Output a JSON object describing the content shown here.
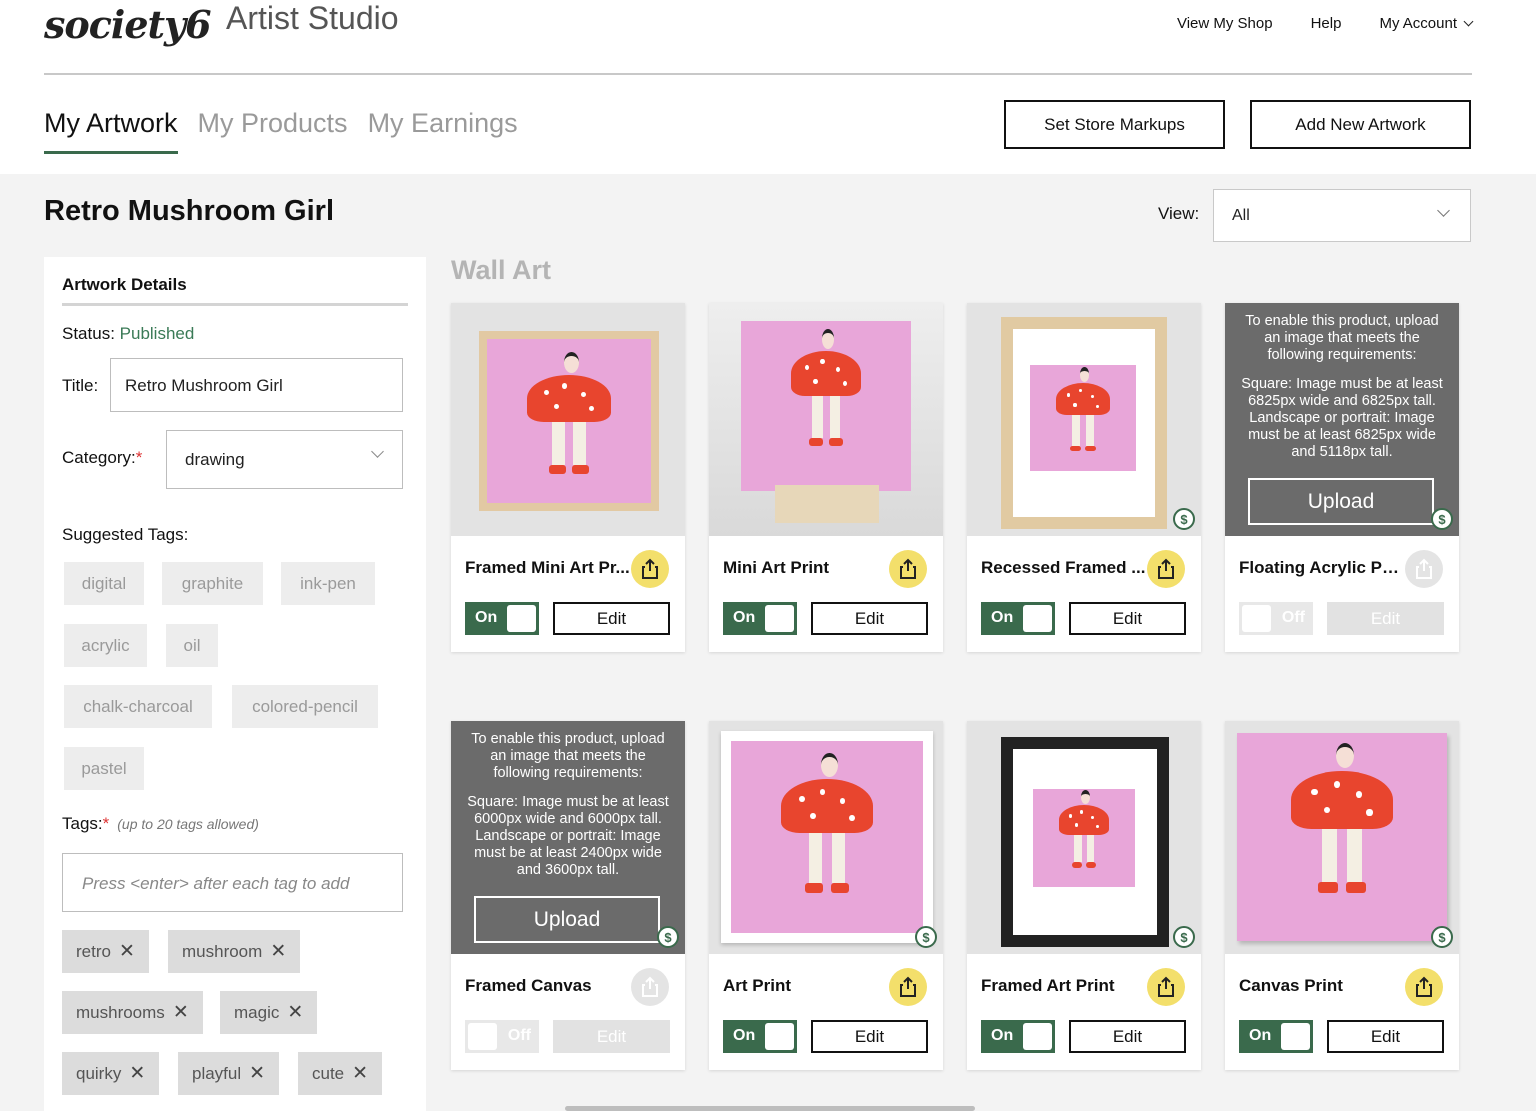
{
  "brand": {
    "logo": "society6",
    "studio": "Artist Studio"
  },
  "topnav": {
    "view_shop": "View My Shop",
    "help": "Help",
    "account": "My Account"
  },
  "tabs": [
    {
      "label": "My Artwork",
      "active": true
    },
    {
      "label": "My Products",
      "active": false
    },
    {
      "label": "My Earnings",
      "active": false
    }
  ],
  "buttons": {
    "markups": "Set Store Markups",
    "add": "Add New Artwork"
  },
  "artwork": {
    "title": "Retro Mushroom Girl",
    "view_label": "View:",
    "view_value": "All"
  },
  "details": {
    "heading": "Artwork Details",
    "status_label": "Status:",
    "status_value": "Published",
    "title_label": "Title:",
    "title_value": "Retro Mushroom Girl",
    "category_label": "Category:",
    "category_value": "drawing",
    "suggested_label": "Suggested Tags:",
    "suggested": [
      "digital",
      "graphite",
      "ink-pen",
      "acrylic",
      "oil",
      "chalk-charcoal",
      "colored-pencil",
      "pastel"
    ],
    "tags_label": "Tags:",
    "tags_hint": "(up to 20 tags allowed)",
    "tags_placeholder": "Press <enter> after each tag to add",
    "tags": [
      "retro",
      "mushroom",
      "mushrooms",
      "magic",
      "quirky",
      "playful",
      "cute"
    ]
  },
  "section": {
    "title": "Wall Art"
  },
  "products": [
    {
      "name": "Framed Mini Art Pr...",
      "enabled": true,
      "toggle": "On",
      "edit": "Edit",
      "dollar": false
    },
    {
      "name": "Mini Art Print",
      "enabled": true,
      "toggle": "On",
      "edit": "Edit",
      "dollar": false
    },
    {
      "name": "Recessed Framed ...",
      "enabled": true,
      "toggle": "On",
      "edit": "Edit",
      "dollar": true
    },
    {
      "name": "Floating Acrylic Pri...",
      "enabled": false,
      "toggle": "Off",
      "edit": "Edit",
      "dollar": true,
      "overlay_1": "To enable this product, upload an image that meets the following requirements:",
      "overlay_2": "Square: Image must be at least 6825px wide and 6825px tall. Landscape or portrait: Image must be at least 6825px wide and 5118px tall.",
      "upload": "Upload"
    },
    {
      "name": "Framed Canvas",
      "enabled": false,
      "toggle": "Off",
      "edit": "Edit",
      "dollar": true,
      "overlay_1": "To enable this product, upload an image that meets the following requirements:",
      "overlay_2": "Square: Image must be at least 6000px wide and 6000px tall. Landscape or portrait: Image must be at least 2400px wide and 3600px tall.",
      "upload": "Upload"
    },
    {
      "name": "Art Print",
      "enabled": true,
      "toggle": "On",
      "edit": "Edit",
      "dollar": true
    },
    {
      "name": "Framed Art Print",
      "enabled": true,
      "toggle": "On",
      "edit": "Edit",
      "dollar": true
    },
    {
      "name": "Canvas Print",
      "enabled": true,
      "toggle": "On",
      "edit": "Edit",
      "dollar": true
    }
  ],
  "icons": {
    "share": "share-upload-icon",
    "dollar": "dollar-badge-icon",
    "remove": "close-icon",
    "dropdown": "chevron-down-icon"
  },
  "colors": {
    "accent_green": "#3a6a4c",
    "share_yellow": "#f3df6b",
    "artwork_pink": "#e8a6d9",
    "mushroom_red": "#e8452e"
  }
}
